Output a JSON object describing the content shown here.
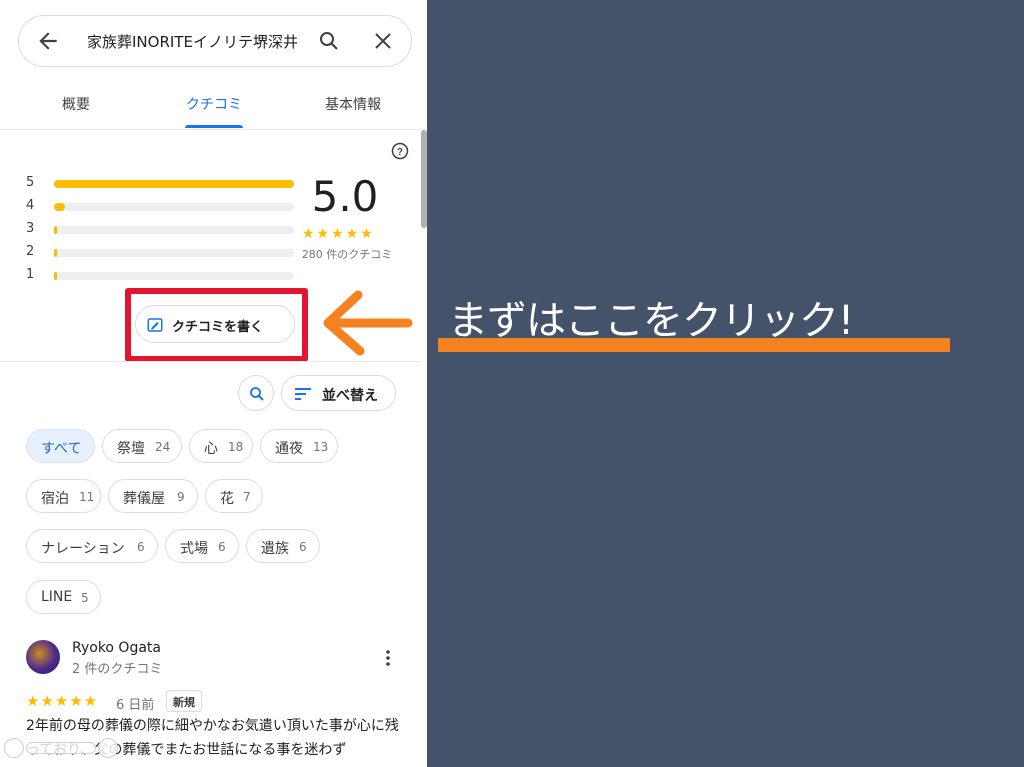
{
  "search": {
    "query": "家族葬INORITEイノリテ堺深井"
  },
  "tabs": [
    {
      "label": "概要"
    },
    {
      "label": "クチコミ"
    },
    {
      "label": "基本情報"
    }
  ],
  "rating": {
    "histogram": [
      {
        "star": "5",
        "fraction": 1.0
      },
      {
        "star": "4",
        "fraction": 0.045
      },
      {
        "star": "3",
        "fraction": 0.01
      },
      {
        "star": "2",
        "fraction": 0.01
      },
      {
        "star": "1",
        "fraction": 0.01
      }
    ],
    "score": "5.0",
    "stars": "★★★★★",
    "count_label": "280 件のクチコミ",
    "accent_color": "#fbbc04"
  },
  "write_review": {
    "label": "クチコミを書く"
  },
  "sort": {
    "label": "並べ替え"
  },
  "chips": [
    {
      "label": "すべて",
      "count": ""
    },
    {
      "label": "祭壇",
      "count": "24"
    },
    {
      "label": "心",
      "count": "18"
    },
    {
      "label": "通夜",
      "count": "13"
    },
    {
      "label": "宿泊",
      "count": "11"
    },
    {
      "label": "葬儀屋",
      "count": "9"
    },
    {
      "label": "花",
      "count": "7"
    },
    {
      "label": "ナレーション",
      "count": "6"
    },
    {
      "label": "式場",
      "count": "6"
    },
    {
      "label": "遺族",
      "count": "6"
    },
    {
      "label": "LINE",
      "count": "5"
    }
  ],
  "review": {
    "name": "Ryoko Ogata",
    "sub": "2 件のクチコミ",
    "stars": "★★★★★",
    "date": "6 日前",
    "badge": "新規",
    "text": "2年前の母の葬儀の際に細やかなお気遣い頂いた事が心に残っており、父の葬儀でまたお世話になる事を迷わず"
  },
  "annotation": {
    "text": "まずはここをクリック!",
    "underline_color": "#f58220",
    "arrow_color": "#f58220",
    "box_color": "#e3142d"
  }
}
